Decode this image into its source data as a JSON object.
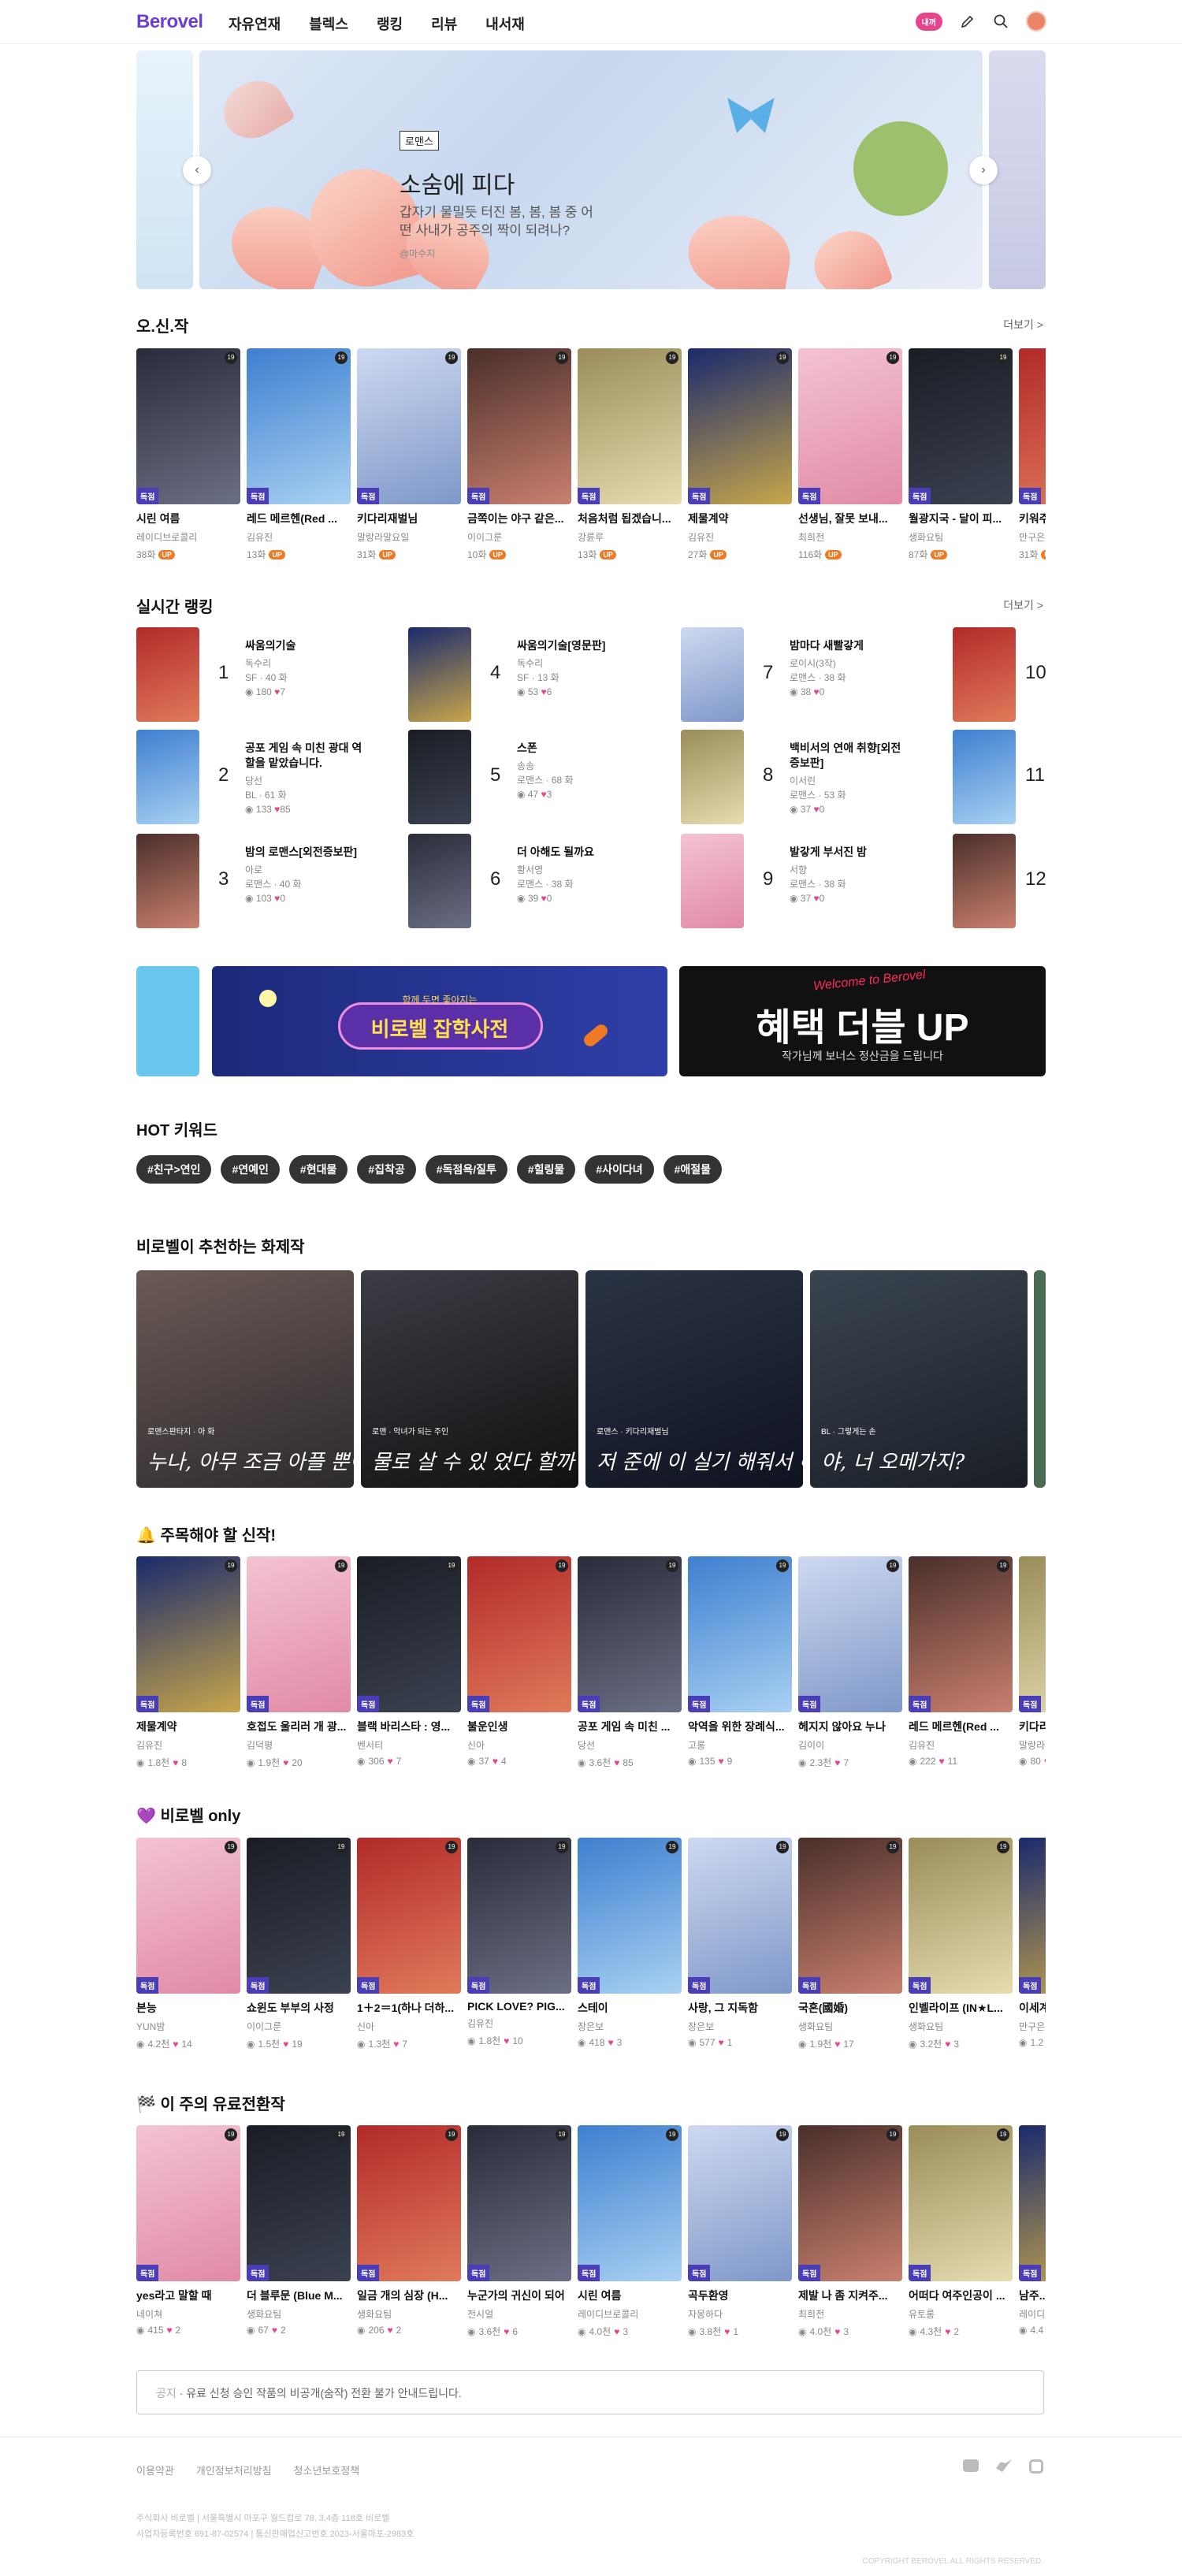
{
  "header": {
    "logo": "Berovel",
    "nav": [
      "자유연재",
      "블렉스",
      "랭킹",
      "리뷰",
      "내서재"
    ],
    "badge": "내꺼"
  },
  "hero": {
    "tag": "로맨스",
    "title": "소숨에 피다",
    "desc": "갑자기 물밀듯 터진 봄, 봄, 봄 중 어떤 사내가 공주의 짝이 되려나?",
    "author": "@마수지"
  },
  "sections": {
    "osinjak": {
      "title": "오.신.작",
      "more": "더보기 >"
    },
    "ranking": {
      "title": "실시간 랭킹",
      "more": "더보기 >"
    },
    "hot": {
      "title": "HOT 키워드"
    },
    "recommend": {
      "title": "비로벨이 추천하는 화제작"
    },
    "newworks": {
      "title": "🔔 주목해야 할 신작!"
    },
    "only": {
      "title": "💜 비로벨 only"
    },
    "paid": {
      "title": "🏁 이 주의 유료전환작"
    }
  },
  "osinjak": [
    {
      "title": "시린 여름",
      "author": "레이디브로콜리",
      "meta": "38화"
    },
    {
      "title": "레드 메르헨(Red ...",
      "author": "김유진",
      "meta": "13화"
    },
    {
      "title": "키다리재벌님",
      "author": "말랑라말요일",
      "meta": "31화"
    },
    {
      "title": "금쪽이는 야구 같은...",
      "author": "이이그룬",
      "meta": "10화"
    },
    {
      "title": "처음처럼 됩겠습니...",
      "author": "강륜루",
      "meta": "13화"
    },
    {
      "title": "제물계약",
      "author": "김유진",
      "meta": "27화"
    },
    {
      "title": "선생님, 잘못 보내...",
      "author": "최희전",
      "meta": "116화"
    },
    {
      "title": "월광지국 - 달이 피...",
      "author": "생화요팀",
      "meta": "87화"
    },
    {
      "title": "키워주...",
      "author": "만구은",
      "meta": "31화"
    }
  ],
  "ranking": [
    {
      "rank": "1",
      "title": "싸움의기술",
      "author": "독수리",
      "genre": "SF · 40 화",
      "views": "180",
      "likes": "7"
    },
    {
      "rank": "2",
      "title": "공포 게임 속 미친 광대 역할을 맡았습니다.",
      "author": "당선",
      "genre": "BL · 61 화",
      "views": "133",
      "likes": "85"
    },
    {
      "rank": "3",
      "title": "밤의 로맨스[외전증보판]",
      "author": "아로",
      "genre": "로맨스 · 40 화",
      "views": "103",
      "likes": "0"
    },
    {
      "rank": "4",
      "title": "싸움의기술[영문판]",
      "author": "독수리",
      "genre": "SF · 13 화",
      "views": "53",
      "likes": "6"
    },
    {
      "rank": "5",
      "title": "스폰",
      "author": "송송",
      "genre": "로맨스 · 68 화",
      "views": "47",
      "likes": "3"
    },
    {
      "rank": "6",
      "title": "더 아해도 될까요",
      "author": "황서영",
      "genre": "로맨스 · 38 화",
      "views": "39",
      "likes": "0"
    },
    {
      "rank": "7",
      "title": "밤마다 새빨갛게",
      "author": "로이시(3작)",
      "genre": "로맨스 · 38 화",
      "views": "38",
      "likes": "0"
    },
    {
      "rank": "8",
      "title": "백비서의 연애 취향[외전증보판]",
      "author": "이서린",
      "genre": "로맨스 · 53 화",
      "views": "37",
      "likes": "0"
    },
    {
      "rank": "9",
      "title": "발갛게 부서진 밤",
      "author": "서향",
      "genre": "로맨스 · 38 화",
      "views": "37",
      "likes": "0"
    },
    {
      "rank": "10",
      "title": "",
      "author": "",
      "genre": "",
      "views": "",
      "likes": ""
    },
    {
      "rank": "11",
      "title": "",
      "author": "",
      "genre": "",
      "views": "",
      "likes": ""
    },
    {
      "rank": "12",
      "title": "",
      "author": "",
      "genre": "",
      "views": "",
      "likes": ""
    }
  ],
  "banners": {
    "b1_sub": "함께 두면 좋아지는",
    "b1_title": "비로벨 잡학사전",
    "b2_script": "Welcome to Berovel",
    "b2_title": "혜택 더블 UP",
    "b2_sub": "작가님께 보너스 정산금을 드립니다"
  },
  "keywords": [
    "#친구>연인",
    "#연예인",
    "#현대물",
    "#집착공",
    "#독점욕/질투",
    "#힐링물",
    "#사이다녀",
    "#애절물"
  ],
  "recommend": [
    {
      "genre": "로맨스판타지 · 아 화",
      "caption": "누나, 아무 조금 아플 뿐이야."
    },
    {
      "genre": "로맨 · 악녀가 되는 주인",
      "caption": "물로 살 수 있 었다 할까 하더"
    },
    {
      "genre": "로맨스 · 키다리재벌님",
      "caption": "저 준에 이 실기 해줘서 해 된 건 되죠?"
    },
    {
      "genre": "BL · 그렇게는 손",
      "caption": "야, 너 오메가지?"
    }
  ],
  "newworks": [
    {
      "title": "제물계약",
      "author": "김유진",
      "views": "1.8천",
      "likes": "8"
    },
    {
      "title": "호접도 울리러 개 광...",
      "author": "김덕평",
      "views": "1.9천",
      "likes": "20"
    },
    {
      "title": "블랙 바리스타 : 영...",
      "author": "벤서티",
      "views": "306",
      "likes": "7"
    },
    {
      "title": "불운인생",
      "author": "신아",
      "views": "37",
      "likes": "4"
    },
    {
      "title": "공포 게임 속 미친 ...",
      "author": "당선",
      "views": "3.6천",
      "likes": "85"
    },
    {
      "title": "악역을 위한 장례식...",
      "author": "고롱",
      "views": "135",
      "likes": "9"
    },
    {
      "title": "헤지지 않아요 누나",
      "author": "김이이",
      "views": "2.3천",
      "likes": "7"
    },
    {
      "title": "레드 메르헨(Red ...",
      "author": "김유진",
      "views": "222",
      "likes": "11"
    },
    {
      "title": "키다리...",
      "author": "말랑라",
      "views": "80",
      "likes": ""
    }
  ],
  "only": [
    {
      "title": "본능",
      "author": "YUN밤",
      "views": "4.2천",
      "likes": "14"
    },
    {
      "title": "쇼윈도 부부의 사정",
      "author": "이이그룬",
      "views": "1.5천",
      "likes": "19"
    },
    {
      "title": "1＋2＝1(하나 더하...",
      "author": "신아",
      "views": "1.3천",
      "likes": "7"
    },
    {
      "title": "PICK LOVE? PIG...",
      "author": "김유진",
      "views": "1.8천",
      "likes": "10"
    },
    {
      "title": "스테이",
      "author": "장은보",
      "views": "418",
      "likes": "3"
    },
    {
      "title": "사랑, 그 지독함",
      "author": "장은보",
      "views": "577",
      "likes": "1"
    },
    {
      "title": "국혼(國婚)",
      "author": "생화요팀",
      "views": "1.9천",
      "likes": "17"
    },
    {
      "title": "인벨라이프 (IN★L...",
      "author": "생화요팀",
      "views": "3.2천",
      "likes": "3"
    },
    {
      "title": "이세계...",
      "author": "만구은",
      "views": "1.2",
      "likes": ""
    }
  ],
  "paid": [
    {
      "title": "yes라고 말할 때",
      "author": "네이쳐",
      "views": "415",
      "likes": "2"
    },
    {
      "title": "더 블루문 (Blue M...",
      "author": "생화요팀",
      "views": "67",
      "likes": "2"
    },
    {
      "title": "일금 개의 심장 (H...",
      "author": "생화요팀",
      "views": "206",
      "likes": "2"
    },
    {
      "title": "누군가의 귀신이 되어",
      "author": "전시얼",
      "views": "3.6천",
      "likes": "6"
    },
    {
      "title": "시린 여름",
      "author": "레이디브로콜리",
      "views": "4.0천",
      "likes": "3"
    },
    {
      "title": "곡두환영",
      "author": "자몽하다",
      "views": "3.8천",
      "likes": "1"
    },
    {
      "title": "제발 나 좀 지켜주...",
      "author": "최희전",
      "views": "4.0천",
      "likes": "3"
    },
    {
      "title": "어떠다 여주인공이 ...",
      "author": "유토롱",
      "views": "4.3천",
      "likes": "2"
    },
    {
      "title": "남주...",
      "author": "레이디",
      "views": "4.4",
      "likes": ""
    }
  ],
  "notice": {
    "label": "공지",
    "text": "· 유료 신청 승인 작품의 비공개(숨작) 전환 불가 안내드립니다."
  },
  "footer": {
    "links": [
      "이용약관",
      "개인정보처리방침",
      "청소년보호정책"
    ],
    "addr1": "주식회사 비로벨 | 서울특별시 마포구 월드컵로 78, 3,4층 118호 비로벨",
    "addr2": "사업자등록번호 691-87-02574 | 통신판매업신고번호 2023-서울마포-2983호",
    "copy": "COPYRIGHT BEROVEL ALL RIGHTS RESERVED."
  },
  "colors": {
    "brand": "#6a3fd6",
    "exclusive": "#4a3db8",
    "up": "#f07a23",
    "heart": "#e5458d"
  }
}
